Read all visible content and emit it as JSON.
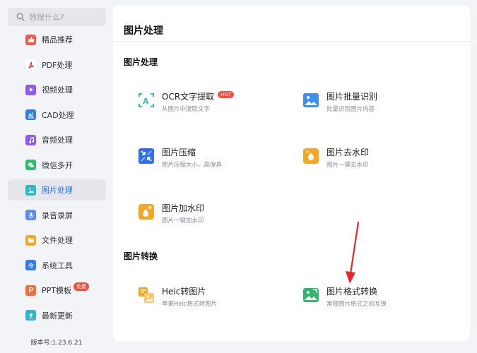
{
  "search": {
    "placeholder": "想搜什么?"
  },
  "sidebar": {
    "items": [
      {
        "label": "精品推荐",
        "icon": "thumb-up-icon",
        "color": "#f25a4b"
      },
      {
        "label": "PDF处理",
        "icon": "pdf-icon",
        "color": "#ffffff"
      },
      {
        "label": "视频处理",
        "icon": "video-icon",
        "color": "#8c5cf0"
      },
      {
        "label": "CAD处理",
        "icon": "cad-icon",
        "color": "#2f7bf0"
      },
      {
        "label": "音频处理",
        "icon": "music-icon",
        "color": "#8c5cf0"
      },
      {
        "label": "微信多开",
        "icon": "wechat-icon",
        "color": "#2fbb6b"
      },
      {
        "label": "图片处理",
        "icon": "image-icon",
        "color": "#2fb8c9"
      },
      {
        "label": "录音录屏",
        "icon": "mic-icon",
        "color": "#5b8cf2"
      },
      {
        "label": "文件处理",
        "icon": "folder-icon",
        "color": "#f5a623"
      },
      {
        "label": "系统工具",
        "icon": "gear-icon",
        "color": "#2f7bf0"
      },
      {
        "label": "PPT模板",
        "icon": "ppt-icon",
        "color": "#f26b3a",
        "badge": "免费"
      },
      {
        "label": "最新更新",
        "icon": "upload-icon",
        "color": "#2fb8c9"
      }
    ],
    "version": "版本号:1.23.6.21"
  },
  "main": {
    "title": "图片处理",
    "sections": [
      {
        "title": "图片处理",
        "tools": [
          {
            "title": "OCR文字提取",
            "desc": "从图片中提取文字",
            "badge": "HOT",
            "icon": "ocr-icon"
          },
          {
            "title": "图片批量识别",
            "desc": "批量识别图片内容",
            "icon": "batch-recognize-icon"
          },
          {
            "title": "图片压缩",
            "desc": "图片压缩大小、高保真",
            "icon": "compress-icon"
          },
          {
            "title": "图片去水印",
            "desc": "图片一键去水印",
            "icon": "remove-watermark-icon"
          },
          {
            "title": "图片加水印",
            "desc": "图片一键加水印",
            "icon": "add-watermark-icon"
          }
        ]
      },
      {
        "title": "图片转换",
        "tools": [
          {
            "title": "Heic转图片",
            "desc": "苹果Heic格式转图片",
            "icon": "heic-icon"
          },
          {
            "title": "图片格式转换",
            "desc": "常规图片格式之间互换",
            "icon": "format-convert-icon"
          }
        ]
      }
    ]
  },
  "colors": {
    "accent": "#2b6cf0",
    "active_bg": "#e4e6ec",
    "annotation_arrow": "#e8252a"
  }
}
